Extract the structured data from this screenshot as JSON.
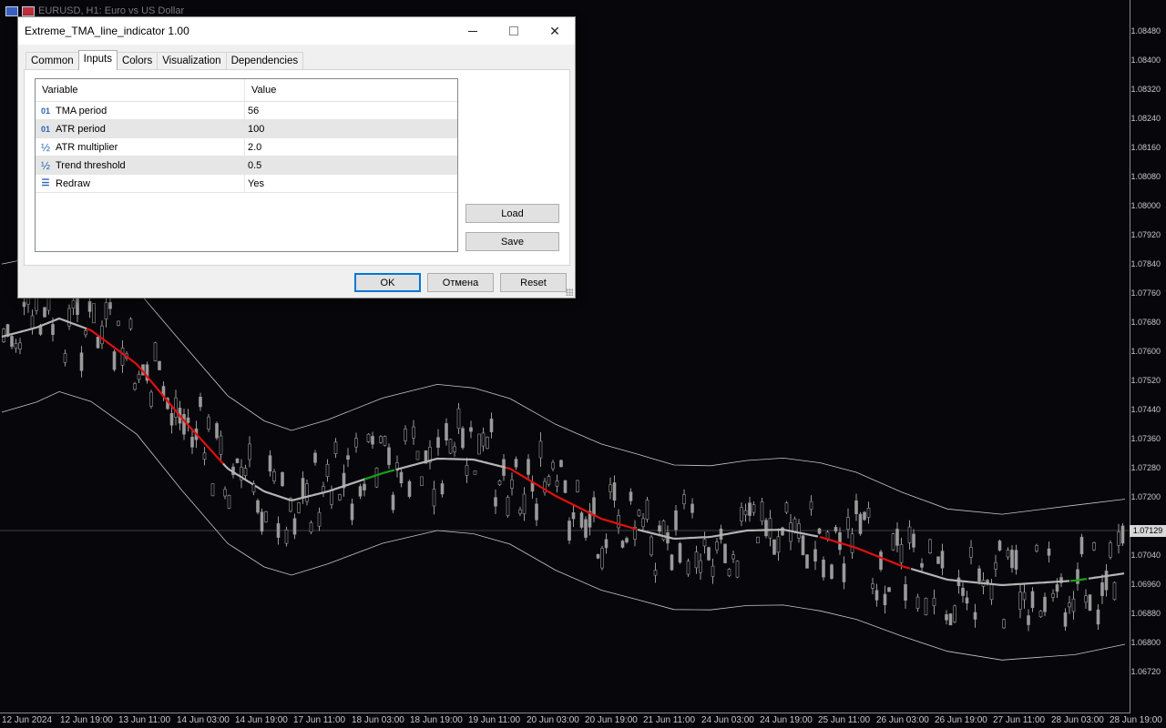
{
  "chart": {
    "title": "EURUSD, H1:  Euro vs US Dollar",
    "current_price": "1.07129",
    "price_labels": [
      "1.08480",
      "1.08400",
      "1.08320",
      "1.08240",
      "1.08160",
      "1.08080",
      "1.08000",
      "1.07920",
      "1.07840",
      "1.07760",
      "1.07680",
      "1.07600",
      "1.07520",
      "1.07440",
      "1.07360",
      "1.07280",
      "1.07200",
      "1.07040",
      "1.06960",
      "1.06880",
      "1.06800",
      "1.06720"
    ],
    "date_labels": [
      "12 Jun 2024",
      "12 Jun 19:00",
      "13 Jun 11:00",
      "14 Jun 03:00",
      "14 Jun 19:00",
      "17 Jun 11:00",
      "18 Jun 03:00",
      "18 Jun 19:00",
      "19 Jun 11:00",
      "20 Jun 03:00",
      "20 Jun 19:00",
      "21 Jun 11:00",
      "24 Jun 03:00",
      "24 Jun 19:00",
      "25 Jun 11:00",
      "26 Jun 03:00",
      "26 Jun 19:00",
      "27 Jun 11:00",
      "28 Jun 03:00",
      "28 Jun 19:00"
    ],
    "colors": {
      "background": "#07070b",
      "candle": "#9a9a9a",
      "tma_neutral": "#b4b4b4",
      "tma_down": "#e01010",
      "tma_up": "#18a018",
      "bands": "#c8c8c8",
      "price_line": "#a0b0b8"
    }
  },
  "dialog": {
    "title": "Extreme_TMA_line_indicator 1.00",
    "tabs": [
      {
        "label": "Common"
      },
      {
        "label": "Inputs"
      },
      {
        "label": "Colors"
      },
      {
        "label": "Visualization"
      },
      {
        "label": "Dependencies"
      }
    ],
    "active_tab": "Inputs",
    "grid": {
      "header_variable": "Variable",
      "header_value": "Value",
      "rows": [
        {
          "icon": "integer-icon",
          "icon_glyph": "01",
          "variable": "TMA period",
          "value": "56"
        },
        {
          "icon": "integer-icon",
          "icon_glyph": "01",
          "variable": "ATR period",
          "value": "100"
        },
        {
          "icon": "double-icon",
          "icon_glyph": "½",
          "variable": "ATR multiplier",
          "value": "2.0"
        },
        {
          "icon": "double-icon",
          "icon_glyph": "½",
          "variable": "Trend threshold",
          "value": "0.5"
        },
        {
          "icon": "enum-icon",
          "icon_glyph": "☰",
          "variable": "Redraw",
          "value": "Yes"
        }
      ]
    },
    "buttons": {
      "load": "Load",
      "save": "Save",
      "ok": "OK",
      "cancel": "Отмена",
      "reset": "Reset"
    },
    "window_controls": {
      "minimize": "—",
      "close": "✕"
    }
  }
}
